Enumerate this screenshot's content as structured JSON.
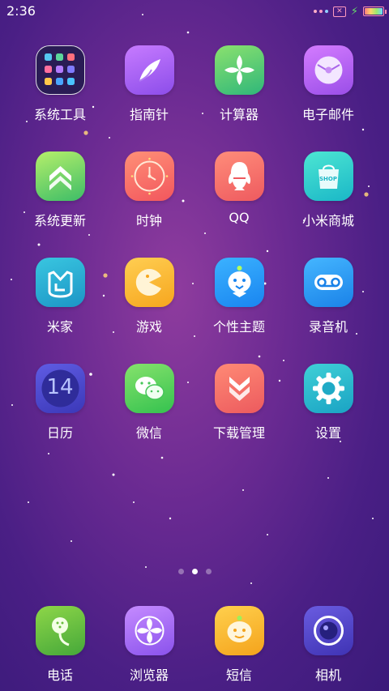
{
  "status_bar": {
    "time": "2:36",
    "indicator_colors": [
      "#ffb0c8",
      "#ff9ec7",
      "#8fd0ff"
    ]
  },
  "apps": [
    {
      "label": "系统工具",
      "icon": "folder-icon"
    },
    {
      "label": "指南针",
      "icon": "compass-icon"
    },
    {
      "label": "计算器",
      "icon": "calculator-icon"
    },
    {
      "label": "电子邮件",
      "icon": "email-icon"
    },
    {
      "label": "系统更新",
      "icon": "system-update-icon"
    },
    {
      "label": "时钟",
      "icon": "clock-icon"
    },
    {
      "label": "QQ",
      "icon": "qq-icon"
    },
    {
      "label": "小米商城",
      "icon": "mi-store-icon"
    },
    {
      "label": "米家",
      "icon": "mijia-icon"
    },
    {
      "label": "游戏",
      "icon": "game-icon"
    },
    {
      "label": "个性主题",
      "icon": "themes-icon"
    },
    {
      "label": "录音机",
      "icon": "recorder-icon"
    },
    {
      "label": "日历",
      "icon": "calendar-icon"
    },
    {
      "label": "微信",
      "icon": "wechat-icon"
    },
    {
      "label": "下载管理",
      "icon": "download-icon"
    },
    {
      "label": "设置",
      "icon": "settings-icon"
    }
  ],
  "calendar_day": "14",
  "store_badge_text": "SHOP",
  "page_indicator": {
    "pages": 3,
    "active": 2
  },
  "dock": [
    {
      "label": "电话",
      "icon": "phone-icon"
    },
    {
      "label": "浏览器",
      "icon": "browser-icon"
    },
    {
      "label": "短信",
      "icon": "messages-icon"
    },
    {
      "label": "相机",
      "icon": "camera-icon"
    }
  ]
}
